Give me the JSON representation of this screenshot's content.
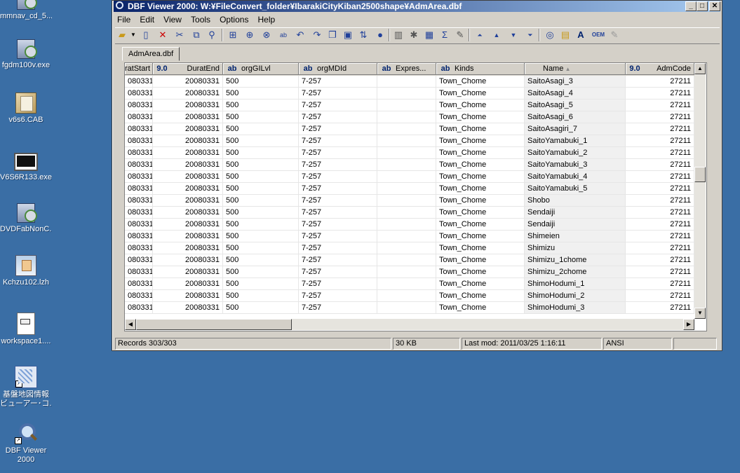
{
  "desktop": {
    "icons": [
      {
        "label": "mmnav_cd_5...",
        "icon": "setup-icon"
      },
      {
        "label": "fgdm100v.exe",
        "icon": "setup-icon"
      },
      {
        "label": "v6s6.CAB",
        "icon": "cab-icon"
      },
      {
        "label": "V6S6R133.exe",
        "icon": "exe-icon"
      },
      {
        "label": "DVDFabNonC...",
        "icon": "setup-icon"
      },
      {
        "label": "Kchzu102.lzh",
        "icon": "lzh-icon"
      },
      {
        "label": "workspace1....",
        "icon": "document-icon"
      },
      {
        "label": "基盤地図情報",
        "label2": "ビューアー･コ...",
        "icon": "map-viewer-icon"
      },
      {
        "label": "DBF Viewer",
        "label2": "2000",
        "icon": "magnifier-icon"
      }
    ]
  },
  "window": {
    "title": "DBF Viewer 2000: W:¥FileConvert_folder¥IbarakiCityKiban2500shape¥AdmArea.dbf",
    "menu": [
      "File",
      "Edit",
      "View",
      "Tools",
      "Options",
      "Help"
    ],
    "tab": "AdmArea.dbf"
  },
  "grid": {
    "columns": [
      {
        "type": "",
        "name": "ratStart"
      },
      {
        "type": "9.0",
        "name": "DuratEnd"
      },
      {
        "type": "ab",
        "name": "orgGILvl"
      },
      {
        "type": "ab",
        "name": "orgMDId"
      },
      {
        "type": "ab",
        "name": "Expres..."
      },
      {
        "type": "ab",
        "name": "Kinds"
      },
      {
        "type": "",
        "name": "Name"
      },
      {
        "type": "9.0",
        "name": "AdmCode"
      }
    ],
    "rows": [
      [
        "080331",
        "20080331",
        "500",
        "7-257",
        "",
        "Town_Chome",
        "SaitoAsagi_3",
        "27211"
      ],
      [
        "080331",
        "20080331",
        "500",
        "7-257",
        "",
        "Town_Chome",
        "SaitoAsagi_4",
        "27211"
      ],
      [
        "080331",
        "20080331",
        "500",
        "7-257",
        "",
        "Town_Chome",
        "SaitoAsagi_5",
        "27211"
      ],
      [
        "080331",
        "20080331",
        "500",
        "7-257",
        "",
        "Town_Chome",
        "SaitoAsagi_6",
        "27211"
      ],
      [
        "080331",
        "20080331",
        "500",
        "7-257",
        "",
        "Town_Chome",
        "SaitoAsagiri_7",
        "27211"
      ],
      [
        "080331",
        "20080331",
        "500",
        "7-257",
        "",
        "Town_Chome",
        "SaitoYamabuki_1",
        "27211"
      ],
      [
        "080331",
        "20080331",
        "500",
        "7-257",
        "",
        "Town_Chome",
        "SaitoYamabuki_2",
        "27211"
      ],
      [
        "080331",
        "20080331",
        "500",
        "7-257",
        "",
        "Town_Chome",
        "SaitoYamabuki_3",
        "27211"
      ],
      [
        "080331",
        "20080331",
        "500",
        "7-257",
        "",
        "Town_Chome",
        "SaitoYamabuki_4",
        "27211"
      ],
      [
        "080331",
        "20080331",
        "500",
        "7-257",
        "",
        "Town_Chome",
        "SaitoYamabuki_5",
        "27211"
      ],
      [
        "080331",
        "20080331",
        "500",
        "7-257",
        "",
        "Town_Chome",
        "Shobo",
        "27211"
      ],
      [
        "080331",
        "20080331",
        "500",
        "7-257",
        "",
        "Town_Chome",
        "Sendaiji",
        "27211"
      ],
      [
        "080331",
        "20080331",
        "500",
        "7-257",
        "",
        "Town_Chome",
        "Sendaiji",
        "27211"
      ],
      [
        "080331",
        "20080331",
        "500",
        "7-257",
        "",
        "Town_Chome",
        "Shimeien",
        "27211"
      ],
      [
        "080331",
        "20080331",
        "500",
        "7-257",
        "",
        "Town_Chome",
        "Shimizu",
        "27211"
      ],
      [
        "080331",
        "20080331",
        "500",
        "7-257",
        "",
        "Town_Chome",
        "Shimizu_1chome",
        "27211"
      ],
      [
        "080331",
        "20080331",
        "500",
        "7-257",
        "",
        "Town_Chome",
        "Shimizu_2chome",
        "27211"
      ],
      [
        "080331",
        "20080331",
        "500",
        "7-257",
        "",
        "Town_Chome",
        "ShimoHodumi_1",
        "27211"
      ],
      [
        "080331",
        "20080331",
        "500",
        "7-257",
        "",
        "Town_Chome",
        "ShimoHodumi_2",
        "27211"
      ],
      [
        "080331",
        "20080331",
        "500",
        "7-257",
        "",
        "Town_Chome",
        "ShimoHodumi_3",
        "27211"
      ]
    ]
  },
  "status": {
    "records": "Records 303/303",
    "size": "30 KB",
    "lastmod": "Last mod: 2011/03/25 1:16:11",
    "encoding": "ANSI"
  }
}
